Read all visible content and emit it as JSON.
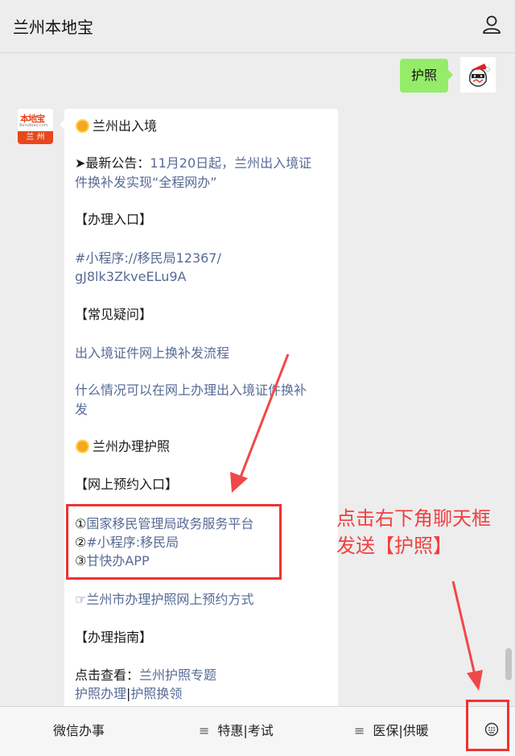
{
  "header": {
    "title": "兰州本地宝"
  },
  "user_message": "护照",
  "bot_avatar": {
    "brand": "本地宝",
    "url": "Bendibao.com",
    "city": "兰 州"
  },
  "card": {
    "section1_title": "兰州出入境",
    "notice_prefix": "➤最新公告：",
    "notice_link_line1": "11月20日起，兰州出入境证",
    "notice_link_line2": "件换补发实现“全程网办”",
    "entry_heading": "【办理入口】",
    "miniapp_line1": "#小程序://移民局12367/",
    "miniapp_line2": "gJ8lk3ZkveELu9A",
    "faq_heading": "【常见疑问】",
    "faq_link1": "出入境证件网上换补发流程",
    "faq_link2_line1": "什么情况可以在网上办理出入境证件换补",
    "faq_link2_line2": "发",
    "section2_title": "兰州办理护照",
    "booking_heading": "【网上预约入口】",
    "booking": [
      {
        "num": "①",
        "text": "国家移民管理局政务服务平台"
      },
      {
        "num": "②",
        "text": "#小程序:移民局"
      },
      {
        "num": "③",
        "text": "甘快办APP"
      }
    ],
    "booking_method": "☞兰州市办理护照网上预约方式",
    "guide_heading": "【办理指南】",
    "view_prefix": "点击查看：",
    "view_link": "兰州护照专题",
    "passport_apply": "护照办理",
    "separator": "|",
    "passport_renew": "护照换领"
  },
  "annotation": {
    "line1": "点击右下角聊天框",
    "line2": "发送【护照】"
  },
  "bottom_menu": {
    "item1": "微信办事",
    "item2": "特惠|考试",
    "item3": "医保|供暖",
    "menu_icon": "≡"
  },
  "colors": {
    "link": "#576b95",
    "annotation_red": "#f04040",
    "bubble_green": "#95ec69"
  }
}
